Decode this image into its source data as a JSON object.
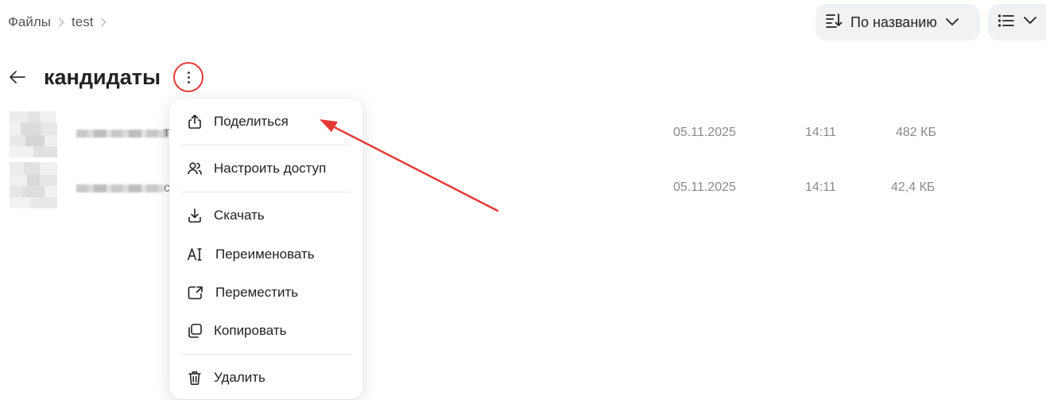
{
  "breadcrumb": {
    "items": [
      "Файлы",
      "test"
    ],
    "separator": "›"
  },
  "toolbar": {
    "sort_label": "По названию",
    "sort_icon": "sort-icon",
    "view_icon": "list-view-icon"
  },
  "folder": {
    "title": "кандидаты"
  },
  "files": [
    {
      "name_tail": "т",
      "date": "05.11.2025",
      "time": "14:11",
      "size": "482 КБ"
    },
    {
      "name_tail": "с",
      "date": "05.11.2025",
      "time": "14:11",
      "size": "42,4 КБ"
    }
  ],
  "context_menu": {
    "items": [
      {
        "label": "Поделиться",
        "icon": "share-icon"
      },
      {
        "label": "Настроить доступ",
        "icon": "users-icon"
      },
      {
        "label": "Скачать",
        "icon": "download-icon"
      },
      {
        "label": "Переименовать",
        "icon": "rename-icon"
      },
      {
        "label": "Переместить",
        "icon": "move-icon"
      },
      {
        "label": "Копировать",
        "icon": "copy-icon"
      },
      {
        "label": "Удалить",
        "icon": "trash-icon"
      }
    ]
  },
  "colors": {
    "annotation": "#e53935",
    "button_bg": "#f1f2f4",
    "muted_text": "#8a8a8a"
  }
}
